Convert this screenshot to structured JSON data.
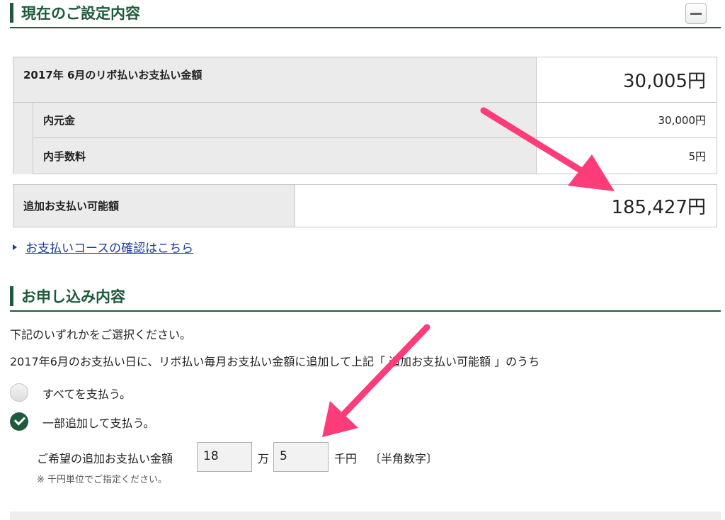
{
  "current_settings": {
    "heading": "現在のご設定内容",
    "rows": {
      "monthly_label": "2017年 6月のリボ払いお支払い金額",
      "monthly_value": "30,005円",
      "principal_label": "内元金",
      "principal_value": "30,000円",
      "fee_label": "内手数料",
      "fee_value": "5円"
    },
    "additional_label": "追加お支払い可能額",
    "additional_value": "185,427円",
    "course_link": "お支払いコースの確認はこちら"
  },
  "application": {
    "heading": "お申し込み内容",
    "instruction": "下記のいずれかをご選択ください。",
    "description": "2017年6月のお支払い日に、リボ払い毎月お支払い金額に追加して上記「 追加お支払い可能額 」のうち",
    "options": [
      {
        "label": "すべてを支払う。",
        "selected": false
      },
      {
        "label": "一部追加して支払う。",
        "selected": true
      }
    ],
    "amount_label": "ご希望の追加お支払い金額",
    "man_value": "18",
    "man_unit": "万",
    "sen_value": "5",
    "sen_unit": "千円",
    "hint": "〔半角数字〕",
    "note": "※ 千円単位でご指定ください。"
  },
  "colors": {
    "accent_green": "#1e5a3c",
    "link_blue": "#1a3a9a",
    "annotation_arrow": "#ff3c7a"
  },
  "icons": [
    "minus-icon",
    "triangle-right-icon",
    "check-icon"
  ]
}
